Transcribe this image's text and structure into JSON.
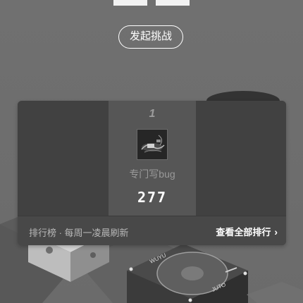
{
  "header": {
    "challenge_button": "发起挑战"
  },
  "leaderboard": {
    "entries": [
      {
        "rank": "1",
        "name": "专门写bug",
        "score": "277"
      }
    ],
    "footer_note": "排行榜 · 每周一凌晨刷新",
    "view_all": "查看全部排行",
    "chevron": "›"
  },
  "decor": {
    "label_left": "WUYU",
    "label_right": "JUTO"
  },
  "icons": {
    "chevron": "chevron-right-icon",
    "avatar": "player-avatar"
  }
}
